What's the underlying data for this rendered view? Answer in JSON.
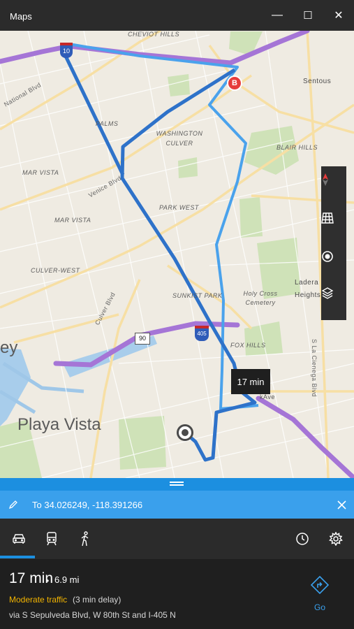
{
  "window": {
    "title": "Maps",
    "controls": {
      "minimize": "—",
      "maximize": "☐",
      "close": "✕"
    }
  },
  "map": {
    "labels": [
      {
        "text": "CHEVIOT HILLS",
        "name": "label-cheviot-hills"
      },
      {
        "text": "PALMS",
        "name": "label-palms"
      },
      {
        "text": "WASHINGTON CULVER",
        "name": "label-washington-culver"
      },
      {
        "text": "MAR VISTA",
        "name": "label-mar-vista"
      },
      {
        "text": "PARK WEST",
        "name": "label-park-west"
      },
      {
        "text": "MAR VISTA",
        "name": "label-mar-vista-2"
      },
      {
        "text": "CULVER-WEST",
        "name": "label-culver-west"
      },
      {
        "text": "SUNKIST PARK",
        "name": "label-sunkist-park"
      },
      {
        "text": "Holy Cross Cemetery",
        "name": "label-holy-cross"
      },
      {
        "text": "FOX HILLS",
        "name": "label-fox-hills"
      },
      {
        "text": "BLAIR HILLS",
        "name": "label-blair-hills"
      },
      {
        "text": "Sentous",
        "name": "label-sentous"
      },
      {
        "text": "Ladera Heights",
        "name": "label-ladera-heights"
      },
      {
        "text": "National Blvd",
        "name": "label-national-blvd"
      },
      {
        "text": "Venice Blvd",
        "name": "label-venice-blvd"
      },
      {
        "text": "Culver Blvd",
        "name": "label-culver-blvd"
      },
      {
        "text": "S La Cienega Blvd",
        "name": "label-la-cienega"
      },
      {
        "text": "Playa Vista",
        "name": "label-playa-vista"
      },
      {
        "text": "ey",
        "name": "label-edge-fragment"
      },
      {
        "text": "kAve",
        "name": "label-ave-fragment"
      }
    ],
    "shields": {
      "i10": "10",
      "i405": "405",
      "r90": "90"
    },
    "marker_b": "B",
    "tooltip": "17 min",
    "tools": [
      "compass-icon",
      "grid-icon",
      "locate-icon",
      "layers-icon"
    ]
  },
  "destination": {
    "text": "To 34.026249, -118.391266"
  },
  "modes": [
    "car-icon",
    "transit-icon",
    "walk-icon"
  ],
  "route": {
    "time": "17 min",
    "separator": "•",
    "distance": "6.9 mi",
    "traffic": "Moderate traffic",
    "delay": "(3 min delay)",
    "via": "via S Sepulveda Blvd, W 80th St and I-405 N",
    "go_label": "Go"
  },
  "colors": {
    "accent": "#1c8fe0",
    "route_primary": "#2e72c9",
    "route_alt": "#4aa2ec",
    "freeway": "#a575d6",
    "traffic_warning": "#f2b400"
  }
}
